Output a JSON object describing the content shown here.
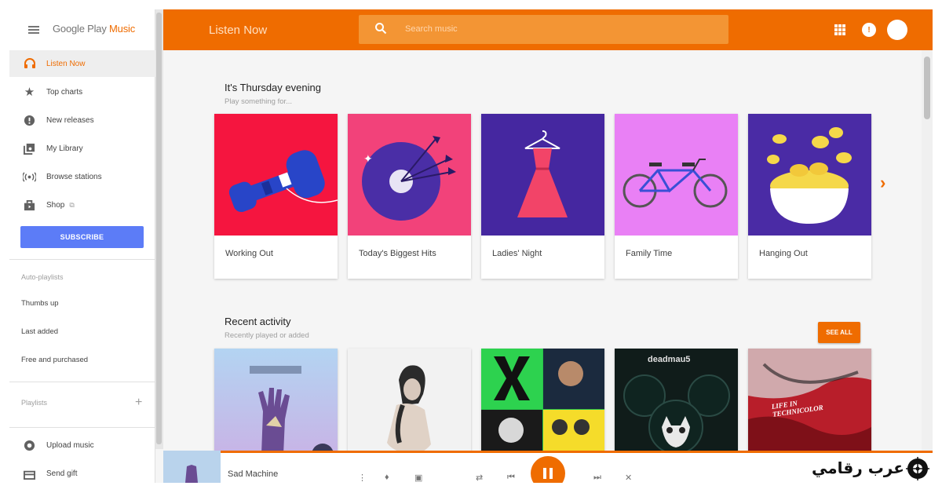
{
  "app": {
    "logo_main": "Google Play",
    "logo_accent": "Music"
  },
  "sidebar": {
    "items": [
      {
        "label": "Listen Now",
        "icon": "headphones-icon",
        "active": true
      },
      {
        "label": "Top charts",
        "icon": "star-icon"
      },
      {
        "label": "New releases",
        "icon": "new-release-icon"
      },
      {
        "label": "My Library",
        "icon": "library-icon"
      },
      {
        "label": "Browse stations",
        "icon": "radio-icon"
      },
      {
        "label": "Shop",
        "icon": "shop-icon"
      }
    ],
    "subscribe_label": "SUBSCRIBE",
    "auto_playlists_label": "Auto-playlists",
    "auto_playlists": [
      "Thumbs up",
      "Last added",
      "Free and purchased"
    ],
    "playlists_label": "Playlists",
    "bottom_items": [
      {
        "label": "Upload music",
        "icon": "upload-icon"
      },
      {
        "label": "Send gift",
        "icon": "gift-icon"
      }
    ]
  },
  "header": {
    "title": "Listen Now",
    "search_placeholder": "Search music"
  },
  "main": {
    "section1": {
      "title": "It's Thursday evening",
      "subtitle": "Play something for...",
      "cards": [
        {
          "label": "Working Out",
          "color": "#f5153f"
        },
        {
          "label": "Today's Biggest Hits",
          "color": "#f2427a"
        },
        {
          "label": "Ladies' Night",
          "color": "#4527a0"
        },
        {
          "label": "Family Time",
          "color": "#e980f5"
        },
        {
          "label": "Hanging Out",
          "color": "#4a2ba5"
        }
      ]
    },
    "section2": {
      "title": "Recent activity",
      "subtitle": "Recently played or added",
      "see_all_label": "SEE ALL",
      "album_4_text": "deadmau5",
      "album_5_text": "LIFE IN TECHNICOLOR"
    }
  },
  "player": {
    "track_title": "Sad Machine"
  },
  "watermark": {
    "text": "عرب رقامي"
  },
  "colors": {
    "accent": "#ef6c00",
    "subscribe": "#5c7cf7"
  }
}
